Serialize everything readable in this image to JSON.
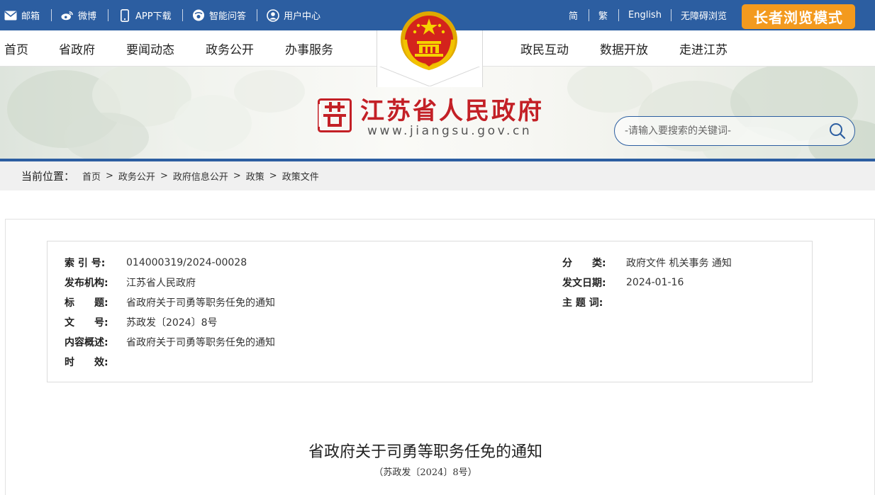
{
  "topbar": {
    "mail": "邮箱",
    "weibo": "微博",
    "app": "APP下载",
    "qa": "智能问答",
    "user_center": "用户中心",
    "simplified": "简",
    "traditional": "繁",
    "english": "English",
    "accessibility": "无障碍浏览",
    "elder_mode": "长者浏览模式"
  },
  "nav": {
    "home": "首页",
    "province": "省政府",
    "news": "要闻动态",
    "affairs": "政务公开",
    "services": "办事服务",
    "interaction": "政民互动",
    "data": "数据开放",
    "jiangsu": "走进江苏"
  },
  "banner": {
    "title": "江苏省人民政府",
    "url": "www.jiangsu.gov.cn",
    "search_placeholder": "-请输入要搜索的关键词-"
  },
  "breadcrumb": {
    "label": "当前位置：",
    "items": [
      "首页",
      "政务公开",
      "政府信息公开",
      "政策",
      "政策文件"
    ],
    "separator": ">"
  },
  "meta": {
    "index_label": "索 引 号:",
    "index_value": "014000319/2024-00028",
    "publisher_label": "发布机构:",
    "publisher_value": "江苏省人民政府",
    "title_label": "标　　题:",
    "title_value": "省政府关于司勇等职务任免的通知",
    "docno_label": "文　　号:",
    "docno_value": "苏政发〔2024〕8号",
    "summary_label": "内容概述:",
    "summary_value": "省政府关于司勇等职务任免的通知",
    "validity_label": "时　　效:",
    "validity_value": "",
    "category_label": "分　　类:",
    "category_value": "政府文件 机关事务 通知",
    "date_label": "发文日期:",
    "date_value": "2024-01-16",
    "topic_label": "主 题 词:",
    "topic_value": ""
  },
  "document": {
    "title": "省政府关于司勇等职务任免的通知",
    "number": "（苏政发〔2024〕8号）"
  },
  "colors": {
    "primary_blue": "#2c5ea1",
    "title_red": "#c32026",
    "elder_orange": "#f39a1e"
  }
}
